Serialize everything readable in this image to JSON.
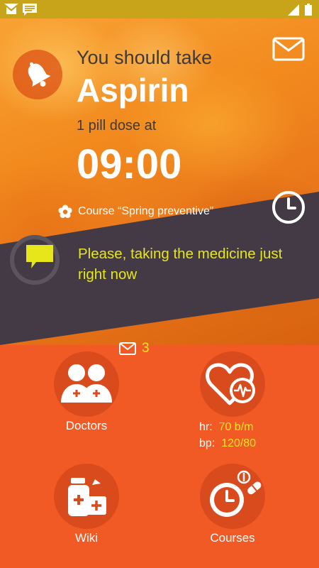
{
  "reminder": {
    "intro": "You should take",
    "medicine": "Aspirin",
    "dose": "1 pill dose at",
    "time": "09:00",
    "course": "Course “Spring preventive”"
  },
  "message": {
    "text": "Please, taking the medicine just right now"
  },
  "tiles": {
    "doctors": {
      "label": "Doctors",
      "unread_count": "3"
    },
    "health": {
      "hr_label": "hr:",
      "hr_value": "70 b/m",
      "bp_label": "bp:",
      "bp_value": "120/80"
    },
    "wiki": {
      "label": "Wiki"
    },
    "courses": {
      "label": "Courses"
    }
  },
  "icons": {
    "status_left": [
      "gmail-icon",
      "message-icon"
    ],
    "status_right": [
      "signal-icon",
      "battery-icon"
    ],
    "hero": [
      "bell-icon",
      "mail-icon",
      "flower-icon",
      "clock-icon",
      "chat-bubble-icon"
    ]
  },
  "colors": {
    "accent_orange": "#f15a24",
    "dark_band": "#433a46",
    "highlight_yellow": "#e6e61a",
    "status_bar": "#c8a41a"
  }
}
